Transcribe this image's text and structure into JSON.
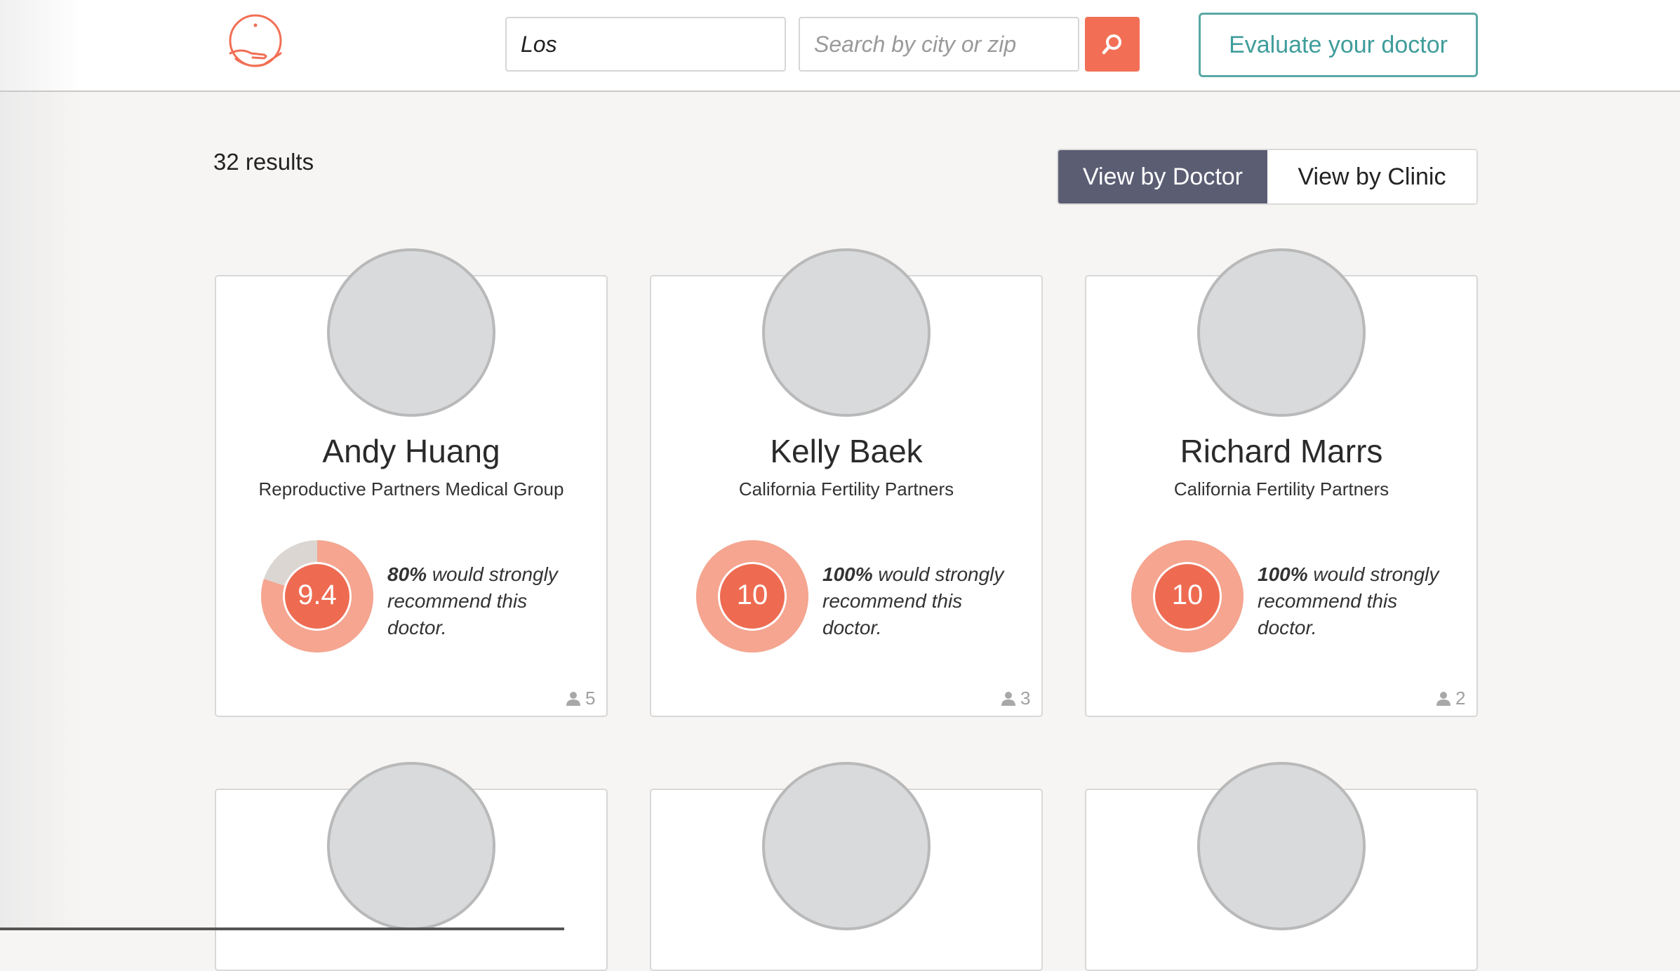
{
  "header": {
    "name_search_value": "Los",
    "location_placeholder": "Search by city or zip",
    "evaluate_button": "Evaluate your doctor"
  },
  "results": {
    "count_label": "32 results"
  },
  "view_toggle": {
    "by_doctor": "View by Doctor",
    "by_clinic": "View by Clinic",
    "selected": "View by Doctor"
  },
  "colors": {
    "accent": "#f26f55",
    "donut_outer": "#f5a590",
    "donut_inner": "#ee6b52",
    "donut_rest": "#dcd6d2",
    "teal": "#3f9d9b",
    "toggle_active": "#5b5d73"
  },
  "doctors": [
    {
      "name": "Andy Huang",
      "clinic": "Reproductive Partners Medical Group",
      "score": "9.4",
      "recommend_pct": "80%",
      "recommend_text": "would strongly recommend this doctor.",
      "recommend_fraction": 0.8,
      "reviews": "5"
    },
    {
      "name": "Kelly Baek",
      "clinic": "California Fertility Partners",
      "score": "10",
      "recommend_pct": "100%",
      "recommend_text": "would strongly recommend this doctor.",
      "recommend_fraction": 1.0,
      "reviews": "3"
    },
    {
      "name": "Richard Marrs",
      "clinic": "California Fertility Partners",
      "score": "10",
      "recommend_pct": "100%",
      "recommend_text": "would strongly recommend this doctor.",
      "recommend_fraction": 1.0,
      "reviews": "2"
    }
  ],
  "icons": {
    "logo": "hand-holding-sun-logo",
    "search": "search-icon",
    "reviewer": "person-icon"
  }
}
